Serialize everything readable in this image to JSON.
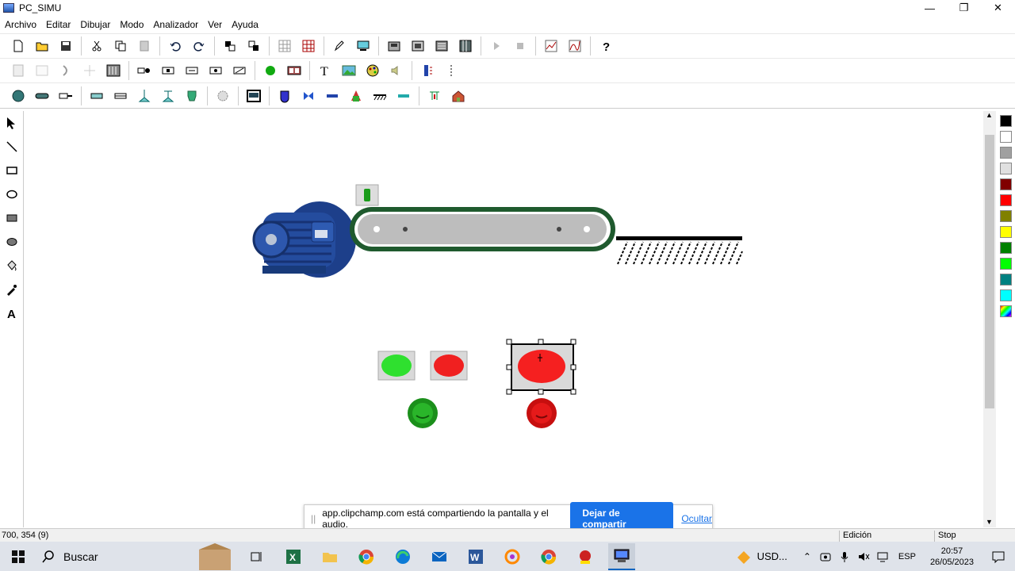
{
  "window": {
    "title": "PC_SIMU"
  },
  "menu": [
    "Archivo",
    "Editar",
    "Dibujar",
    "Modo",
    "Analizador",
    "Ver",
    "Ayuda"
  ],
  "statusbar": {
    "coords": "700, 354 (9)",
    "mode": "Edición",
    "run_state": "Stop"
  },
  "share_bar": {
    "message": "app.clipchamp.com está compartiendo la pantalla y el audio.",
    "stop_label": "Dejar de compartir",
    "hide_label": "Ocultar"
  },
  "taskbar": {
    "search_placeholder": "Buscar",
    "tray_currency": "USD...",
    "language": "ESP",
    "time": "20:57",
    "date": "26/05/2023"
  },
  "palette_colors": [
    "#000000",
    "#ffffff",
    "#a0a0a0",
    "#e0e0e0",
    "#800000",
    "#ff0000",
    "#808000",
    "#ffff00",
    "#008000",
    "#00ff00",
    "#008080",
    "#00ffff"
  ],
  "window_controls": {
    "minimize": "—",
    "restore": "❐",
    "close": "✕"
  }
}
